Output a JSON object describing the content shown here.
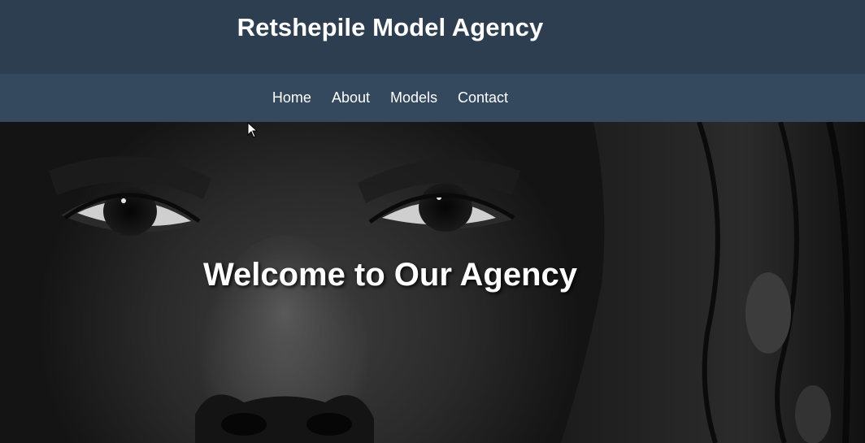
{
  "header": {
    "title": "Retshepile Model Agency",
    "background": "#2c3e50"
  },
  "nav": {
    "background": "#34495e",
    "items": [
      {
        "label": "Home"
      },
      {
        "label": "About"
      },
      {
        "label": "Models"
      },
      {
        "label": "Contact"
      }
    ]
  },
  "hero": {
    "heading": "Welcome to Our Agency",
    "image": "black-and-white-face-closeup"
  },
  "cursor": {
    "icon": "mouse-pointer-icon"
  }
}
